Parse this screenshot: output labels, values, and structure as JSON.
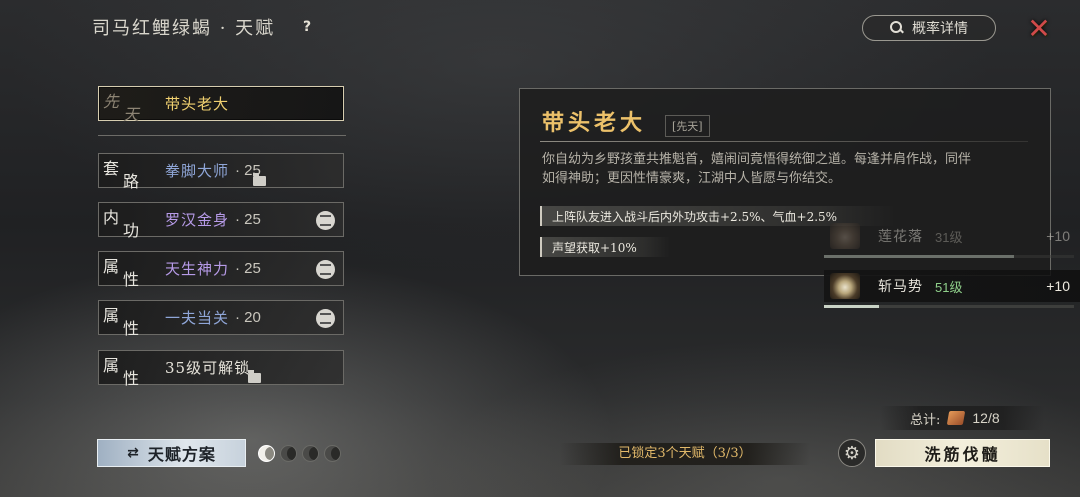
{
  "header": {
    "title": "司马红鲤绿蝎 · 天赋",
    "help": "?",
    "probability_button": "概率详情"
  },
  "selected_slot": {
    "category": [
      "先",
      "天"
    ],
    "name": "带头老大",
    "name_color": "#f0d070"
  },
  "slots": [
    {
      "category": [
        "套",
        "路"
      ],
      "name": "拳脚大师",
      "level": "· 25",
      "name_color": "#8fa6d8",
      "icon": "folder-icon"
    },
    {
      "category": [
        "内",
        "功"
      ],
      "name": "罗汉金身",
      "level": "· 25",
      "name_color": "#b79be8",
      "icon": "toggle-icon"
    },
    {
      "category": [
        "属",
        "性"
      ],
      "name": "天生神力",
      "level": "· 25",
      "name_color": "#b79be8",
      "icon": "toggle-icon"
    },
    {
      "category": [
        "属",
        "性"
      ],
      "name": "一夫当关",
      "level": "· 20",
      "name_color": "#8fa6d8",
      "icon": "toggle-icon"
    },
    {
      "category": [
        "属",
        "性"
      ],
      "name": "35级可解锁",
      "level": "",
      "name_color": "#e6e3da",
      "icon": "folder-icon"
    }
  ],
  "detail": {
    "title": "带头老大",
    "tag": "[先天]",
    "description": "你自幼为乡野孩童共推魁首，嬉闹间竟悟得统御之道。每逢并肩作战，同伴如得神助；更因性情豪爽，江湖中人皆愿与你结交。",
    "effects": [
      "上阵队友进入战斗后内外功攻击+2.5%、气血+2.5%",
      "声望获取+10%"
    ]
  },
  "skills": [
    {
      "name": "莲花落",
      "level": "31级",
      "bonus": "+10",
      "progress": 0.76
    },
    {
      "name": "斩马势",
      "level": "51级",
      "bonus": "+10",
      "progress": 0.22
    }
  ],
  "footer": {
    "scheme_button": "天赋方案",
    "scheme_dots": 4,
    "active_dot": 0,
    "locked_text": "已锁定3个天赋（3/3）",
    "total_label": "总计:",
    "total_value": "12/8",
    "wash_button": "洗筋伐髓"
  }
}
